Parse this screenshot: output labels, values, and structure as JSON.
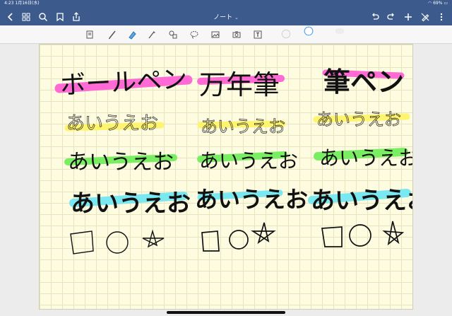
{
  "status": {
    "time": "4:23",
    "date": "1月16日(水)",
    "battery": "69%"
  },
  "nav": {
    "title": "ノート",
    "title_chevron": "⌄"
  },
  "toolbar": {
    "tools": [
      "page-thumbnail-icon",
      "pen-icon",
      "highlighter-icon",
      "brush-icon",
      "shapes-icon",
      "lasso-icon",
      "image-icon",
      "camera-icon",
      "textbox-icon"
    ],
    "colors": [
      "#e6e6e6",
      "#5aa8e6",
      "#d0d0d0"
    ]
  },
  "note": {
    "headers": [
      "ボールペン",
      "万年筆",
      "筆ペン"
    ],
    "sample_text": "あいうえお",
    "highlight_colors": {
      "pink": "#ff6ad5",
      "yellow": "#fff46e",
      "green": "#7aee62",
      "cyan": "#7ae8f0"
    }
  }
}
